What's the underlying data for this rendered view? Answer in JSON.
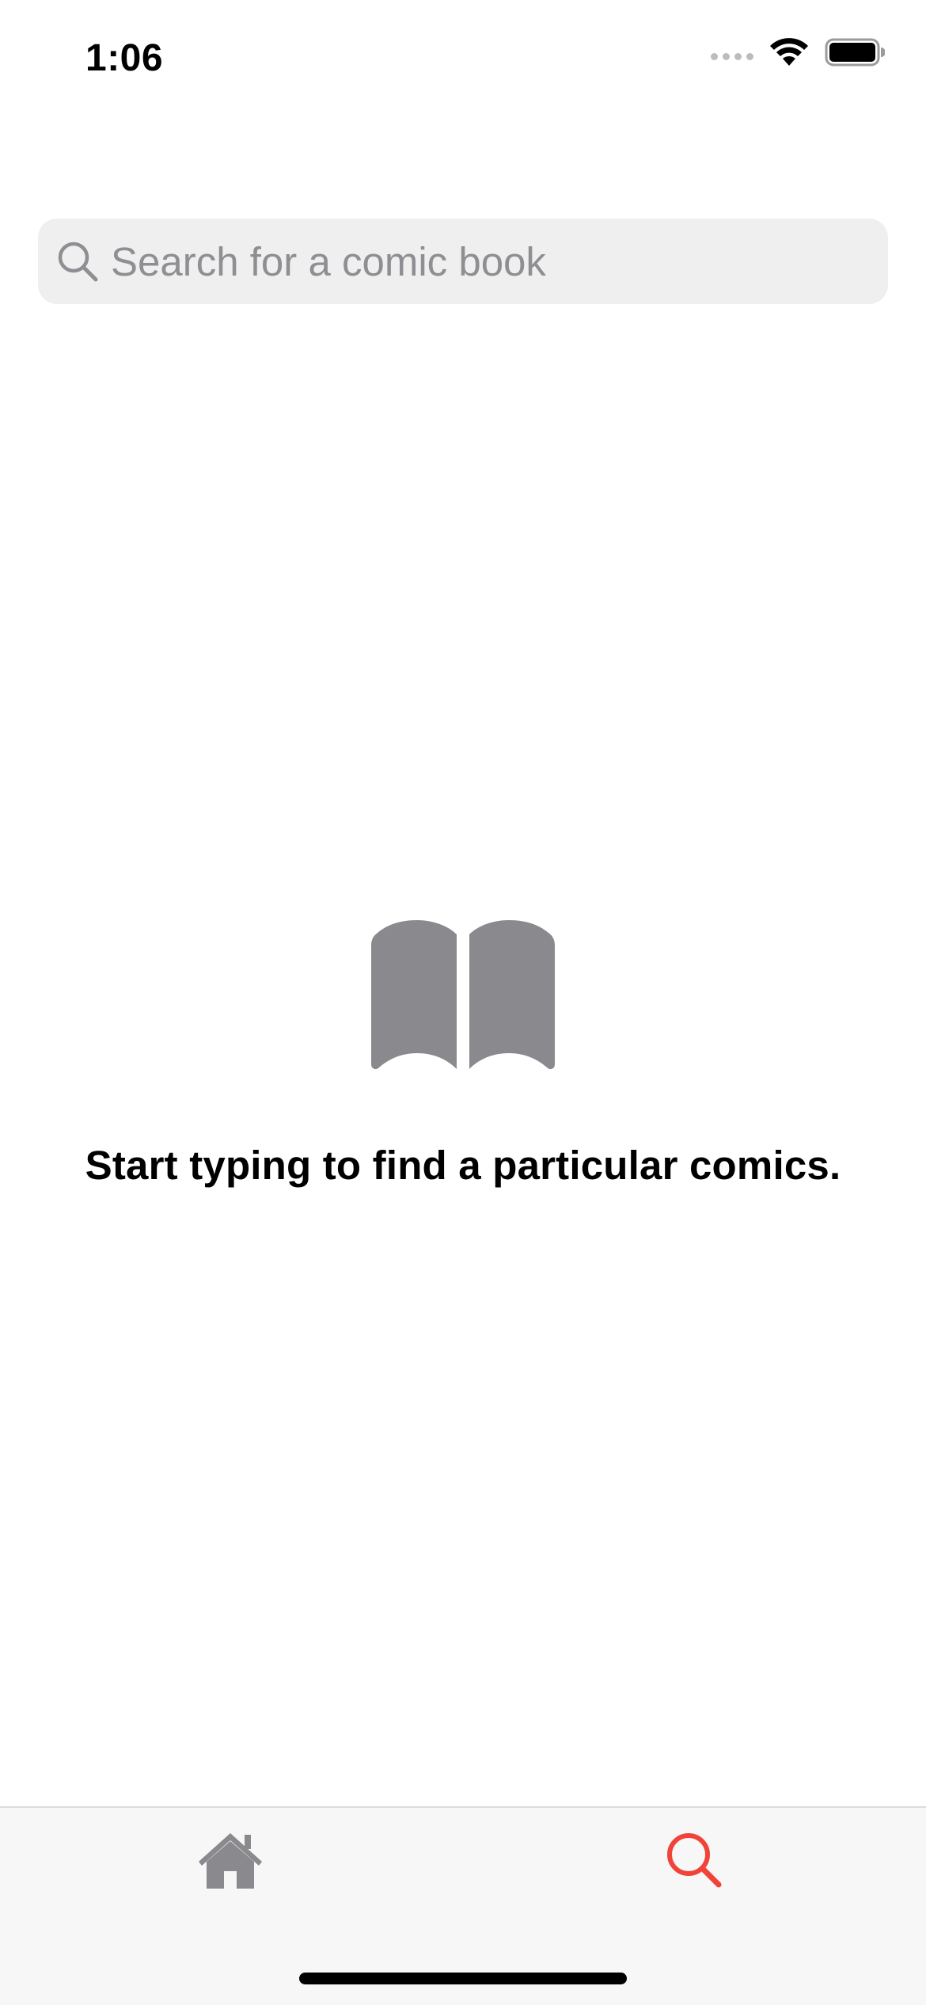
{
  "status_bar": {
    "time": "1:06",
    "icons": [
      "cellular-signal-icon",
      "wifi-icon",
      "battery-icon"
    ]
  },
  "search": {
    "placeholder": "Search for a comic book",
    "value": ""
  },
  "empty_state": {
    "icon": "book-icon",
    "message": "Start typing to find a particular comics."
  },
  "tab_bar": {
    "tabs": [
      {
        "icon": "house-icon",
        "selected": false
      },
      {
        "icon": "search-icon",
        "selected": true
      }
    ]
  },
  "colors": {
    "accent": "#f0443a",
    "inactive_icon": "#8a8a8e",
    "search_background": "#efefef",
    "tab_bar_background": "#f7f7f7"
  }
}
